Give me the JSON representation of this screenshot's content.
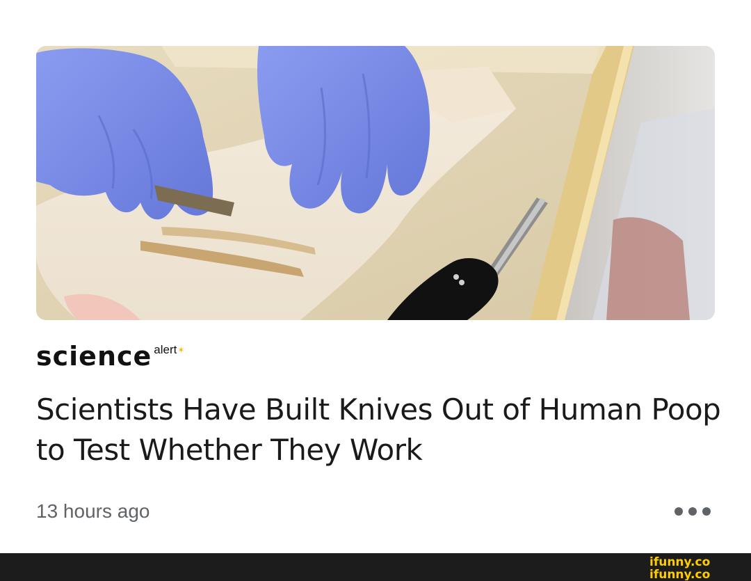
{
  "article": {
    "source": {
      "name_main": "science",
      "name_sup": "alert"
    },
    "headline": "Scientists Have Built Knives Out of Human Poop to Test Whether They Work",
    "timestamp": "13 hours ago",
    "more_icon": "more-horizontal-icon"
  },
  "hero_image": {
    "depicts": "gloved hands shaping material on a tray with a screwdriver"
  },
  "watermark": {
    "text": "ifunny.co"
  },
  "colors": {
    "glove": "#7d8fe8",
    "text_primary": "#1a1a1a",
    "text_secondary": "#5f6368",
    "footer": "#1c1c1c",
    "watermark": "#ffcc00"
  }
}
